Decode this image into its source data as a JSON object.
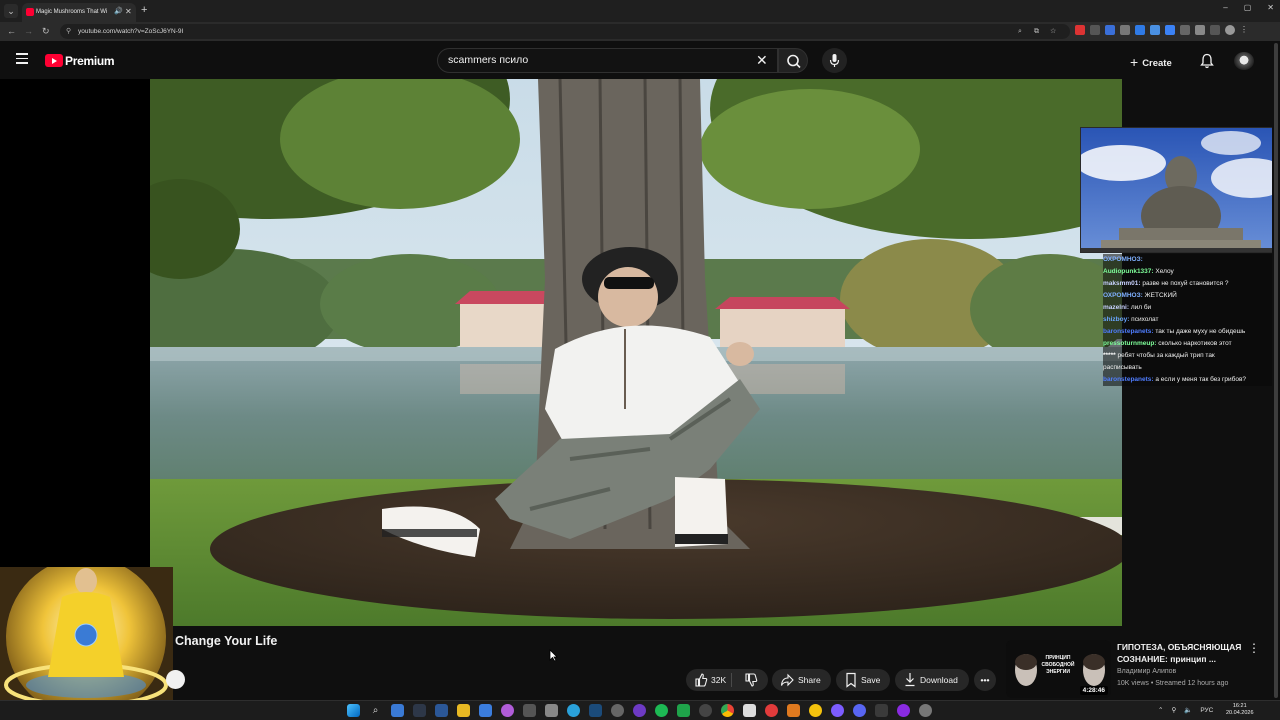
{
  "browser": {
    "tab_title": "Magic Mushrooms That Wi",
    "url": "youtube.com/watch?v=ZoScJ6YN-9I",
    "new_tab_label": "+",
    "window_controls": [
      "–",
      "▢",
      "✕"
    ]
  },
  "youtube": {
    "brand": "Premium",
    "search_value": "scammers псило",
    "create_label": "Create"
  },
  "buddha_chat": [
    {
      "user": "ОХРОМНОЗ:",
      "text": "",
      "color": "#7fb0ff"
    },
    {
      "user": "Audiopunk1337:",
      "text": "Хелоу",
      "color": "#7fff9a"
    },
    {
      "user": "maksmm01:",
      "text": "разве не похуй становится ?",
      "color": "#c9d2ff"
    },
    {
      "user": "ОХРОМНОЗ:",
      "text": "ЖЕТСКИЙ",
      "color": "#7fb0ff"
    },
    {
      "user": "mazelni:",
      "text": "лил би",
      "color": "#c9d2ff"
    },
    {
      "user": "shizboy:",
      "text": "психолат",
      "color": "#6aa6ff"
    },
    {
      "user": "baronstepanets:",
      "text": "так ты даже муху не обидешь",
      "color": "#4f7dff"
    },
    {
      "user": "pressoturnmeup:",
      "text": "сколько наркотиков этот",
      "color": "#7fff9a"
    },
    {
      "user": "*****",
      "text": "ребят чтобы за каждый трип так",
      "color": "#ffffff"
    },
    {
      "user": "",
      "text": "расписывать",
      "color": "#ffffff"
    },
    {
      "user": "baronstepanets:",
      "text": "а если у меня так без грибов?",
      "color": "#4f7dff"
    }
  ],
  "video": {
    "title": "Change Your Life",
    "likes": "32K",
    "share_label": "Share",
    "save_label": "Save",
    "download_label": "Download"
  },
  "recommendation": {
    "title": "ГИПОТЕЗА, ОБЪЯСНЯЮЩАЯ СОЗНАНИЕ: принцип ...",
    "channel": "Владимир Алипов",
    "meta": "10K views • Streamed 12 hours ago",
    "duration": "4:28:46",
    "thumb_text": "ПРИНЦИП СВОБОДНОЙ ЭНЕРГИИ"
  },
  "taskbar": {
    "lang": "РУС",
    "time": "16:21",
    "date": "20.04.2026"
  },
  "colors": {
    "yt_red": "#ff0033",
    "background": "#0f0f0f",
    "pill": "#272727"
  }
}
